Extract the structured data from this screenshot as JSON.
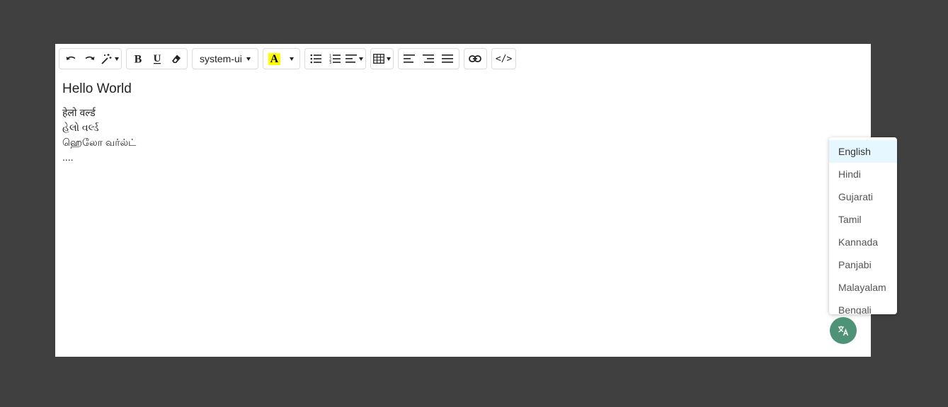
{
  "toolbar": {
    "font_family_value": "system-ui",
    "color_letter": "A",
    "code_label": "</>"
  },
  "content": {
    "heading": "Hello World",
    "lines": [
      "हेलो वर्ल्ड",
      "હેલો વર્લ્ડ",
      "ஹெலோ வர்ல்ட்",
      "...."
    ]
  },
  "language_menu": {
    "selected": "English",
    "options": [
      "English",
      "Hindi",
      "Gujarati",
      "Tamil",
      "Kannada",
      "Panjabi",
      "Malayalam",
      "Bengali"
    ]
  },
  "colors": {
    "background": "#404040",
    "translate_button": "#4e9278",
    "highlight": "#ffff00",
    "menu_active": "#e6f7ff"
  },
  "icons": {
    "translate_button": "translate-icon"
  }
}
